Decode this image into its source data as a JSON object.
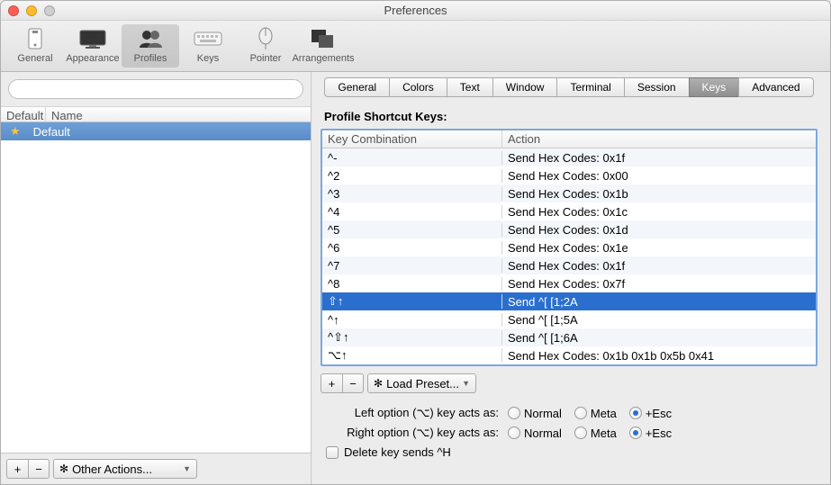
{
  "window": {
    "title": "Preferences"
  },
  "toolbar": {
    "items": [
      {
        "label": "General"
      },
      {
        "label": "Appearance"
      },
      {
        "label": "Profiles"
      },
      {
        "label": "Keys"
      },
      {
        "label": "Pointer"
      },
      {
        "label": "Arrangements"
      }
    ]
  },
  "sidebar": {
    "columns": {
      "default": "Default",
      "name": "Name"
    },
    "profiles": [
      {
        "name": "Default",
        "starred": true
      }
    ],
    "footer": {
      "plus": "+",
      "minus": "−",
      "other": "Other Actions..."
    }
  },
  "tabs": [
    "General",
    "Colors",
    "Text",
    "Window",
    "Terminal",
    "Session",
    "Keys",
    "Advanced"
  ],
  "keys": {
    "title": "Profile Shortcut Keys:",
    "columns": {
      "key": "Key Combination",
      "action": "Action"
    },
    "rows": [
      {
        "key": "^-",
        "action": "Send Hex Codes: 0x1f"
      },
      {
        "key": "^2",
        "action": "Send Hex Codes: 0x00"
      },
      {
        "key": "^3",
        "action": "Send Hex Codes: 0x1b"
      },
      {
        "key": "^4",
        "action": "Send Hex Codes: 0x1c"
      },
      {
        "key": "^5",
        "action": "Send Hex Codes: 0x1d"
      },
      {
        "key": "^6",
        "action": "Send Hex Codes: 0x1e"
      },
      {
        "key": "^7",
        "action": "Send Hex Codes: 0x1f"
      },
      {
        "key": "^8",
        "action": "Send Hex Codes: 0x7f"
      },
      {
        "key": "⇧↑",
        "action": "Send ^[ [1;2A",
        "selected": true
      },
      {
        "key": "^↑",
        "action": "Send ^[ [1;5A"
      },
      {
        "key": "^⇧↑",
        "action": "Send ^[ [1;6A"
      },
      {
        "key": "⌥↑",
        "action": "Send Hex Codes: 0x1b 0x1b 0x5b 0x41"
      }
    ],
    "controls": {
      "plus": "+",
      "minus": "−",
      "preset": "Load Preset..."
    }
  },
  "options": {
    "left": {
      "label": "Left option (⌥) key acts as:",
      "value": "+Esc"
    },
    "right": {
      "label": "Right option (⌥) key acts as:",
      "value": "+Esc"
    },
    "choices": {
      "normal": "Normal",
      "meta": "Meta",
      "esc": "+Esc"
    },
    "delete": {
      "label": "Delete key sends ^H",
      "checked": false
    }
  }
}
